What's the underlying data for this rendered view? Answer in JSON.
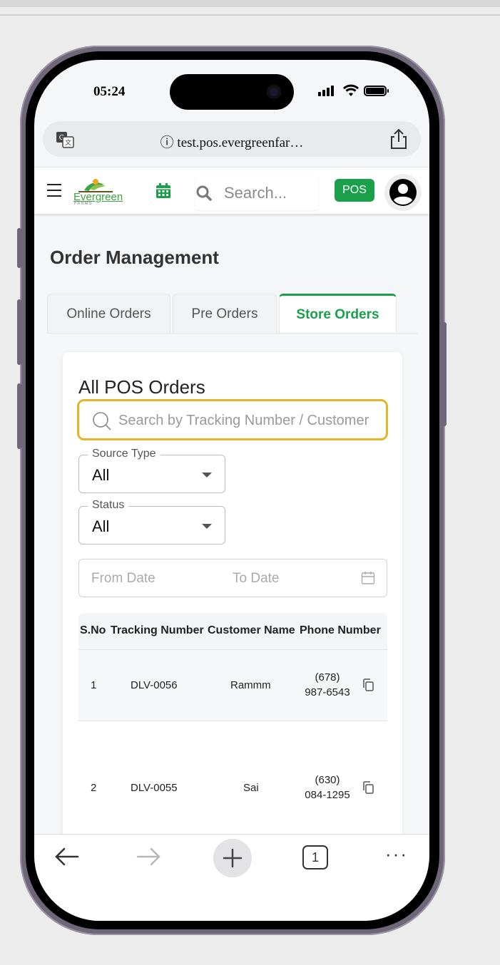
{
  "status_bar": {
    "time": "05:24"
  },
  "browser": {
    "url": "test.pos.evergreenfar…",
    "url_prefix_icon": "info-icon",
    "tab_count": "1"
  },
  "header": {
    "logo_text": "Evergreen",
    "logo_sub": "FARMS",
    "search_placeholder": "Search...",
    "pos_label": "POS",
    "brand_color": "#1aa04a"
  },
  "page": {
    "title": "Order Management",
    "tabs": [
      {
        "label": "Online Orders",
        "active": false
      },
      {
        "label": "Pre Orders",
        "active": false
      },
      {
        "label": "Store Orders",
        "active": true
      }
    ]
  },
  "card": {
    "title": "All POS Orders",
    "search_placeholder": "Search by Tracking Number / Customer",
    "filters": {
      "source_type": {
        "label": "Source Type",
        "value": "All"
      },
      "status": {
        "label": "Status",
        "value": "All"
      }
    },
    "date_range": {
      "from_placeholder": "From Date",
      "to_placeholder": "To Date"
    },
    "table": {
      "columns": [
        "S.No",
        "Tracking Number",
        "Customer Name",
        "Phone Number"
      ],
      "rows": [
        {
          "sno": "1",
          "tracking": "DLV-0056",
          "customer": "Rammm",
          "phone_line1": "(678)",
          "phone_line2": "987-6543"
        },
        {
          "sno": "2",
          "tracking": "DLV-0055",
          "customer": "Sai",
          "phone_line1": "(630)",
          "phone_line2": "084-1295"
        }
      ]
    }
  }
}
